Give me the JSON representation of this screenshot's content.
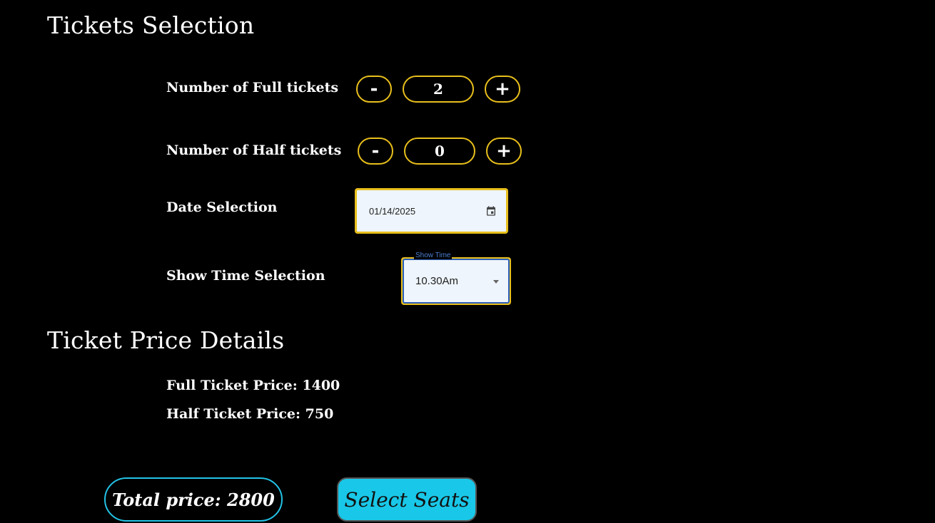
{
  "tickets_section": {
    "title": "Tickets Selection",
    "full": {
      "label": "Number of Full tickets",
      "minus": "-",
      "value": "2",
      "plus": "+"
    },
    "half": {
      "label": "Number of Half tickets",
      "minus": "-",
      "value": "0",
      "plus": "+"
    },
    "date": {
      "label": "Date Selection",
      "value": "01/14/2025",
      "icon": "calendar-icon"
    },
    "show_time": {
      "label": "Show Time Selection",
      "legend": "Show Time",
      "value": "10.30Am",
      "icon": "dropdown-arrow-icon"
    }
  },
  "price_section": {
    "title": "Ticket Price Details",
    "full_price": "Full Ticket Price: 1400",
    "half_price": "Half Ticket Price: 750"
  },
  "footer": {
    "total": "Total price: 2800",
    "select_seats": "Select Seats"
  },
  "colors": {
    "accent_border": "#e8bf1c",
    "cyan": "#19c8e8",
    "background": "#000000"
  }
}
